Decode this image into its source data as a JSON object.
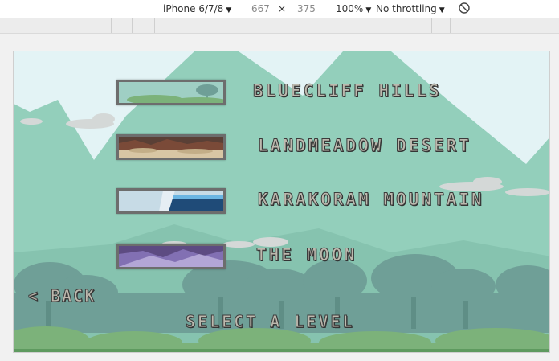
{
  "devtools": {
    "device": "iPhone 6/7/8",
    "width": "667",
    "times": "×",
    "height": "375",
    "zoom": "100%",
    "throttling": "No throttling",
    "rotate_icon": "rotate-icon"
  },
  "game": {
    "levels": [
      {
        "label": "BLUECLIFF HILLS",
        "thumb": "hills"
      },
      {
        "label": "LANDMEADOW DESERT",
        "thumb": "desert"
      },
      {
        "label": "KARAKORAM MOUNTAIN",
        "thumb": "mountain"
      },
      {
        "label": "THE MOON",
        "thumb": "moon"
      }
    ],
    "back_label": "< BACK",
    "title": "SELECT A LEVEL"
  },
  "colors": {
    "sky": "#e3f3f5",
    "mountain": "#93cfbb",
    "trees": "#6f9f97",
    "grass": "#7cb27a",
    "label_fill": "#bdb9ae",
    "label_outline": "#3b3b3b"
  }
}
